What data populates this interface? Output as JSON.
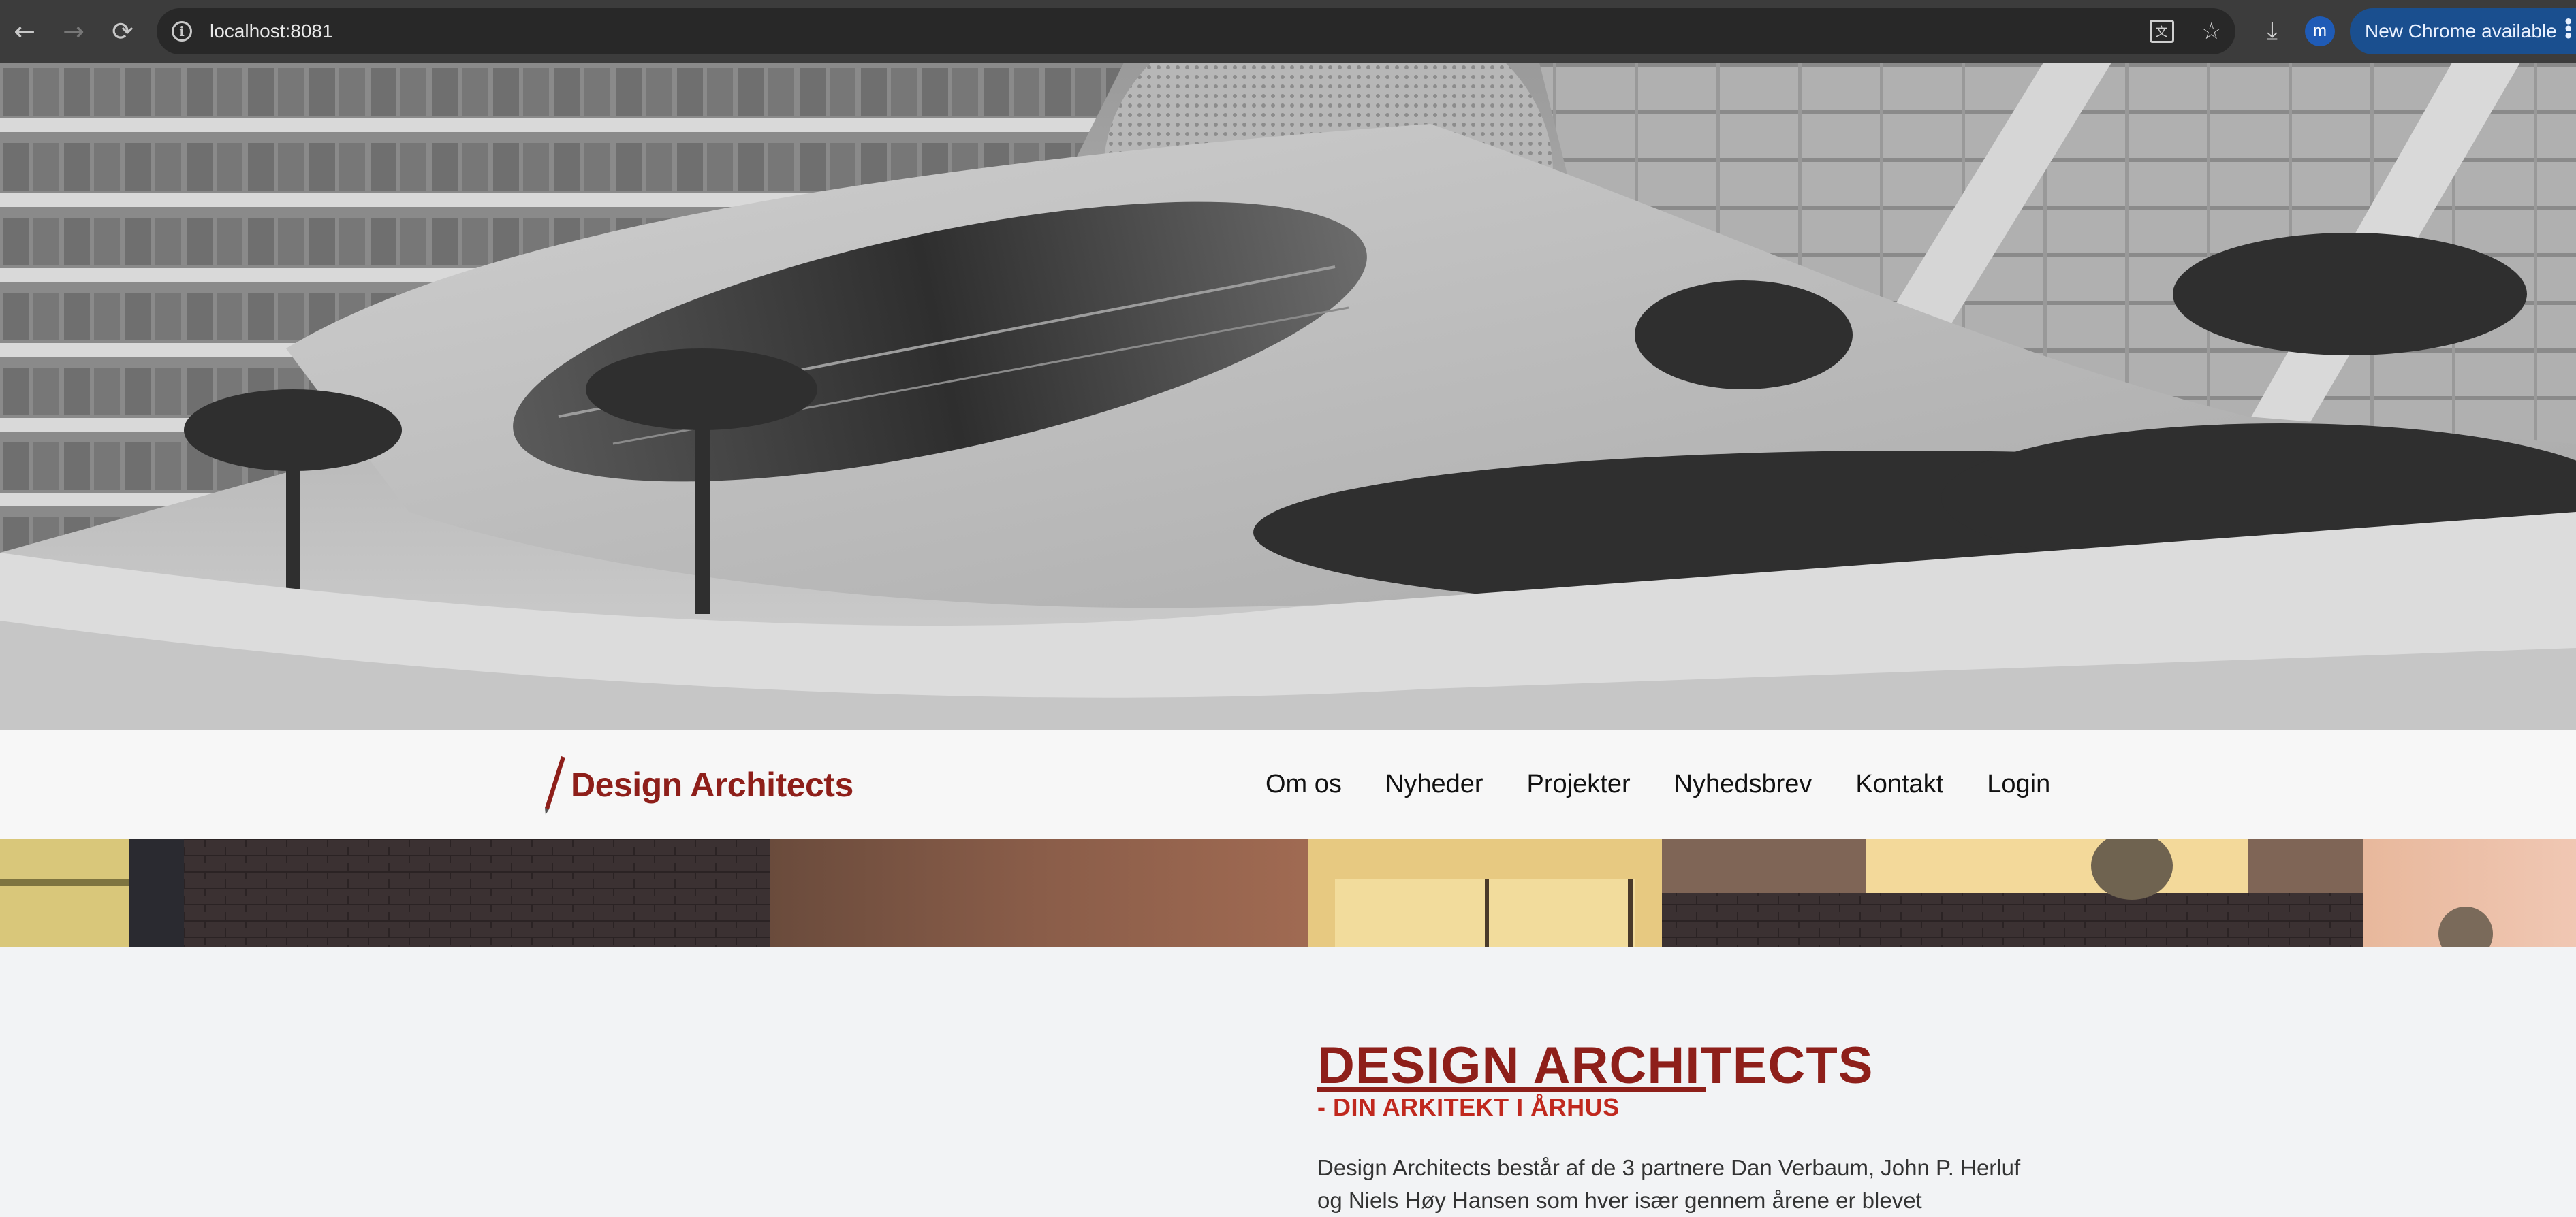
{
  "browser": {
    "url": "localhost:8081",
    "update_label": "New Chrome available",
    "avatar_initial": "m"
  },
  "site": {
    "brand_name": "Design Architects",
    "brand_color": "#8e1f1a",
    "nav": [
      {
        "label": "Om os"
      },
      {
        "label": "Nyheder"
      },
      {
        "label": "Projekter"
      },
      {
        "label": "Nyhedsbrev"
      },
      {
        "label": "Kontakt"
      },
      {
        "label": "Login"
      }
    ]
  },
  "main": {
    "headline": "DESIGN ARCHITECTS",
    "subheadline": "- DIN ARKITEKT I ÅRHUS",
    "intro": "Design Architects består af de 3 partnere Dan Verbaum, John P. Herluf og Niels Høy Hansen som hver især gennem årene er blevet"
  }
}
